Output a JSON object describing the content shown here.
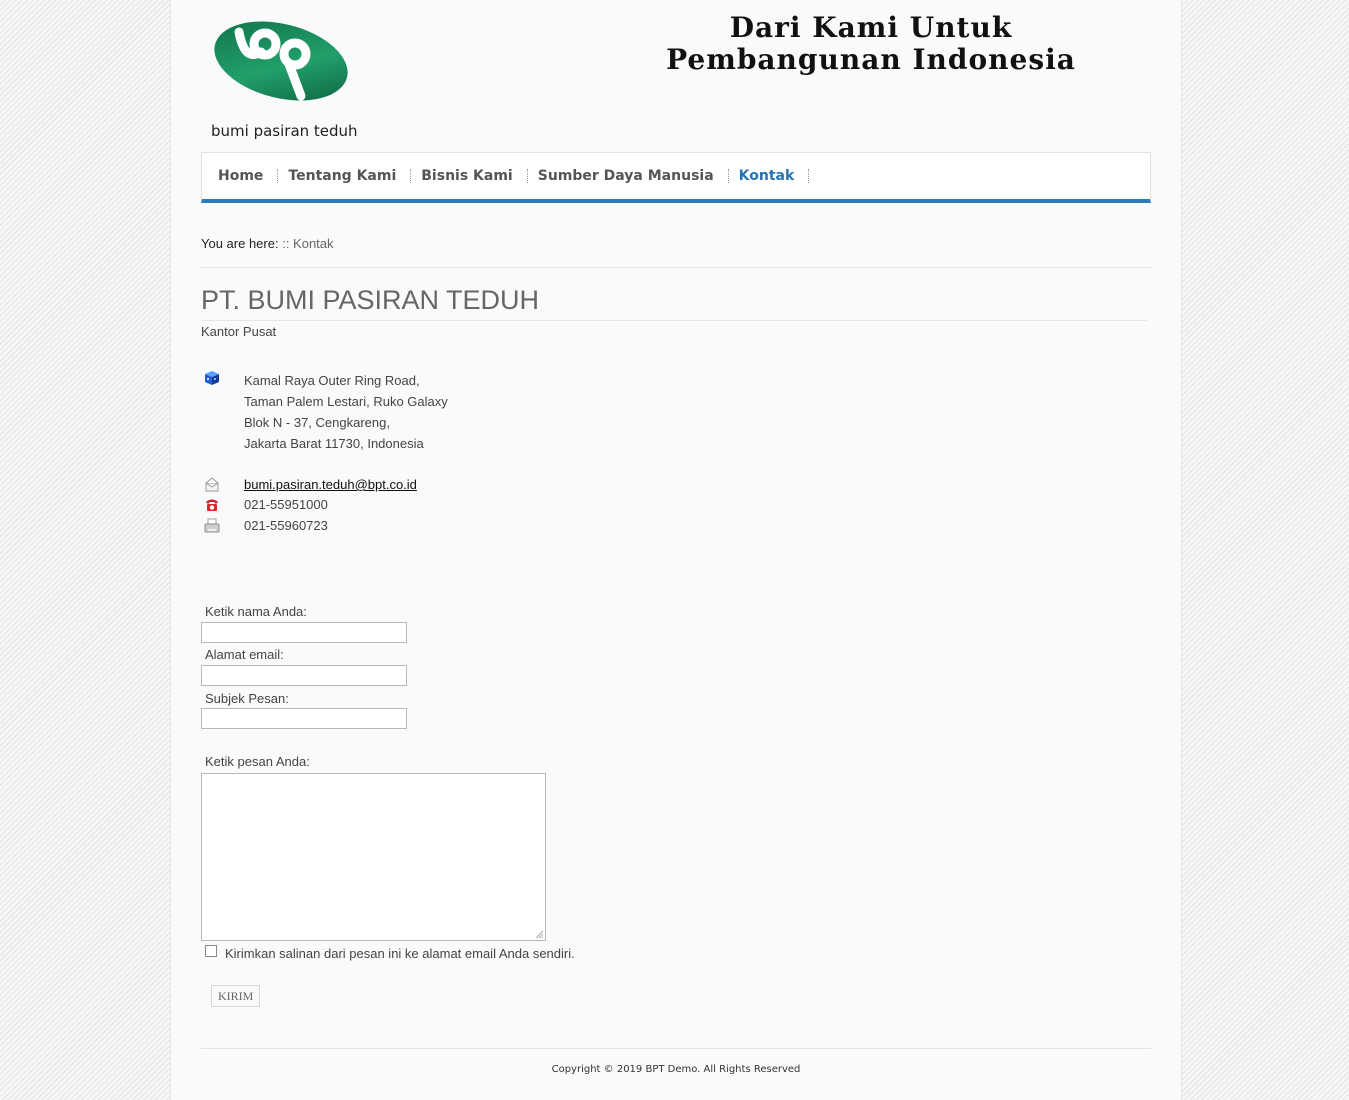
{
  "header": {
    "logo_text": "bumi pasiran teduh",
    "slogan_line1": "Dari Kami Untuk",
    "slogan_line2": "Pembangunan Indonesia"
  },
  "nav": {
    "items": [
      {
        "label": "Home"
      },
      {
        "label": "Tentang Kami"
      },
      {
        "label": "Bisnis Kami"
      },
      {
        "label": "Sumber Daya Manusia"
      },
      {
        "label": "Kontak",
        "active": true
      }
    ]
  },
  "breadcrumb": {
    "prefix": "You are here:",
    "current": ":: Kontak"
  },
  "company": {
    "name": "PT. BUMI PASIRAN TEDUH",
    "subtitle": "Kantor Pusat",
    "address": [
      "Kamal Raya Outer Ring Road,",
      "Taman Palem Lestari, Ruko Galaxy",
      "Blok N - 37, Cengkareng,",
      "Jakarta Barat 11730, Indonesia"
    ],
    "email": "bumi.pasiran.teduh@bpt.co.id",
    "phone": "021-55951000",
    "fax": "021-55960723"
  },
  "icons": {
    "address": "building-icon",
    "email": "envelope-icon",
    "phone": "telephone-icon",
    "fax": "fax-icon"
  },
  "form": {
    "name_label": "Ketik nama Anda:",
    "email_label": "Alamat email:",
    "subject_label": "Subjek Pesan:",
    "message_label": "Ketik pesan Anda:",
    "name_value": "",
    "email_value": "",
    "subject_value": "",
    "message_value": "",
    "copy_label": "Kirimkan salinan dari pesan ini ke alamat email Anda sendiri.",
    "copy_checked": false,
    "submit_label": "KIRIM"
  },
  "footer": {
    "copyright": "Copyright © 2019 BPT Demo. All Rights Reserved"
  },
  "colors": {
    "accent": "#2e7bb8",
    "active_nav": "#2673b4",
    "logo_green": "#1a8a5c"
  }
}
